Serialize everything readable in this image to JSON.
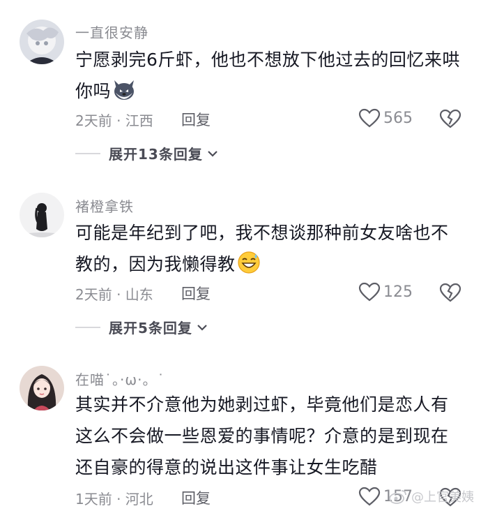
{
  "comments": [
    {
      "username": "一直很安静",
      "text": "宁愿剥完6斤虾，他也不想放下他过去的回忆来哄你吗",
      "emoji": "husky-face-emoji",
      "meta": "2天前 · 江西",
      "reply_label": "回复",
      "likes": "565",
      "expand_label": "展开13条回复"
    },
    {
      "username": "褚橙拿铁",
      "text": "可能是年纪到了吧，我不想谈那种前女友啥也不教的，因为我懒得教",
      "emoji": "grinning-sweat-emoji",
      "meta": "2天前 · 山东",
      "reply_label": "回复",
      "likes": "125",
      "expand_label": "展开5条回复"
    },
    {
      "username": "在喵˙。·ω·。˙",
      "text": "其实并不介意他为她剥过虾，毕竟他们是恋人有这么不会做一些恩爱的事情呢？介意的是到现在还自豪的得意的说出这件事让女生吃醋",
      "meta": "1天前 · 河北",
      "reply_label": "回复",
      "likes": "157"
    }
  ],
  "watermark": "@上官美姨",
  "colors": {
    "text": "#161823",
    "meta": "#8a8b91",
    "background": "#ffffff"
  }
}
